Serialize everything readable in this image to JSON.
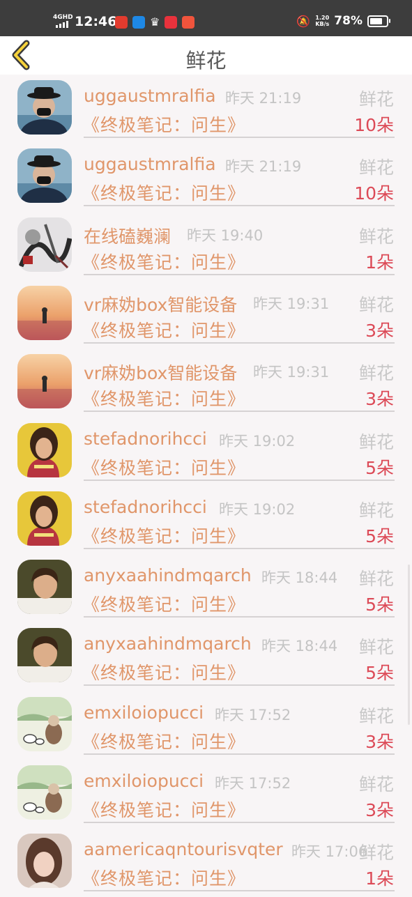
{
  "status_bar": {
    "network": "4GHD",
    "time": "12:46",
    "net_speed_value": "1.20",
    "net_speed_unit": "KB/s",
    "battery_percent": "78%",
    "battery_level": 0.78
  },
  "nav": {
    "title": "鲜花",
    "back_icon": "chevron-left-icon"
  },
  "rows": [
    {
      "name": "uggaustmralfia",
      "time": "昨天 21:19",
      "kind": "鲜花",
      "book": "《终极笔记：问生》",
      "count": "10朵",
      "avatar": "man-mask"
    },
    {
      "name": "uggaustmralfia",
      "time": "昨天 21:19",
      "kind": "鲜花",
      "book": "《终极笔记：问生》",
      "count": "10朵",
      "avatar": "man-mask"
    },
    {
      "name": "在线磕巍澜",
      "time": "昨天 19:40",
      "kind": "鲜花",
      "book": "《终极笔记：问生》",
      "count": "1朵",
      "avatar": "ink-art"
    },
    {
      "name": "vr麻妫box智能设备",
      "time": "昨天 19:31",
      "kind": "鲜花",
      "book": "《终极笔记：问生》",
      "count": "3朵",
      "avatar": "sunset"
    },
    {
      "name": "vr麻妫box智能设备",
      "time": "昨天 19:31",
      "kind": "鲜花",
      "book": "《终极笔记：问生》",
      "count": "3朵",
      "avatar": "sunset"
    },
    {
      "name": "stefadnorihcci",
      "time": "昨天 19:02",
      "kind": "鲜花",
      "book": "《终极笔记：问生》",
      "count": "5朵",
      "avatar": "woman-yellow"
    },
    {
      "name": "stefadnorihcci",
      "time": "昨天 19:02",
      "kind": "鲜花",
      "book": "《终极笔记：问生》",
      "count": "5朵",
      "avatar": "woman-yellow"
    },
    {
      "name": "anyxaahindmqarch",
      "time": "昨天 18:44",
      "kind": "鲜花",
      "book": "《终极笔记：问生》",
      "count": "5朵",
      "avatar": "young-man"
    },
    {
      "name": "anyxaahindmqarch",
      "time": "昨天 18:44",
      "kind": "鲜花",
      "book": "《终极笔记：问生》",
      "count": "5朵",
      "avatar": "young-man"
    },
    {
      "name": "emxiloiopucci",
      "time": "昨天 17:52",
      "kind": "鲜花",
      "book": "《终极笔记：问生》",
      "count": "3朵",
      "avatar": "cartoon-cats"
    },
    {
      "name": "emxiloiopucci",
      "time": "昨天 17:52",
      "kind": "鲜花",
      "book": "《终极笔记：问生》",
      "count": "3朵",
      "avatar": "cartoon-cats"
    },
    {
      "name": "aamericaqntourisvqter",
      "time": "昨天 17:06",
      "kind": "鲜花",
      "book": "《终极笔记：问生》",
      "count": "1朵",
      "avatar": "woman-portrait"
    }
  ],
  "colors": {
    "name": "#e0966a",
    "count": "#dc4a57",
    "muted": "#c4c4c4",
    "statusbar": "#3d3d3d"
  }
}
